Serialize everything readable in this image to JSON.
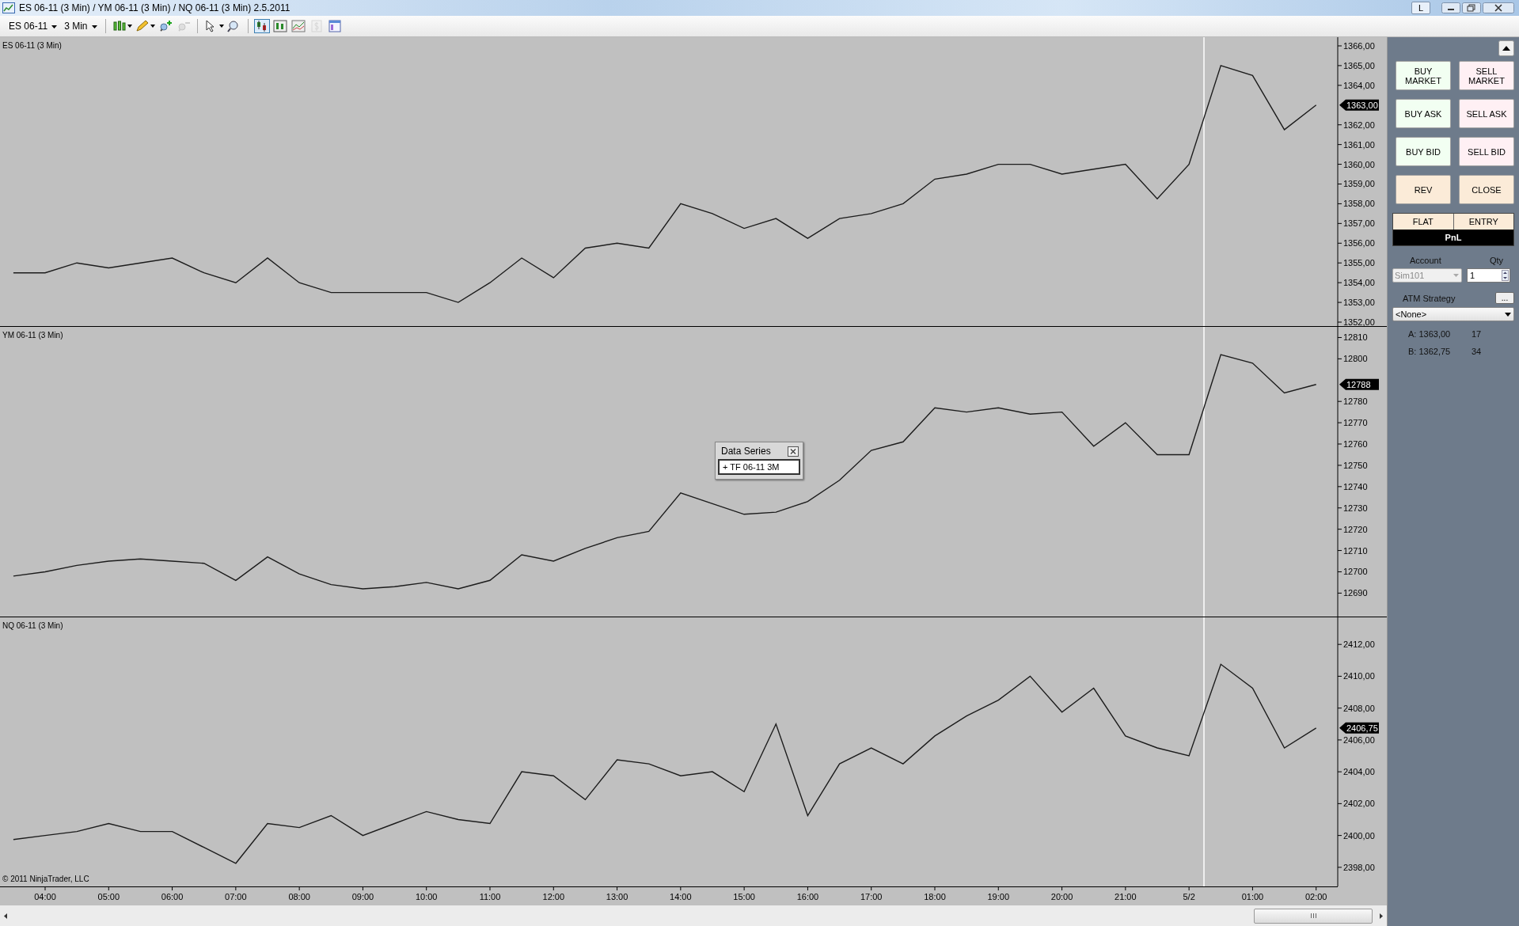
{
  "window": {
    "title": "ES 06-11 (3 Min) / YM 06-11 (3 Min) / NQ 06-11 (3 Min)  2.5.2011",
    "layout_button": "L"
  },
  "toolbar": {
    "instrument": "ES 06-11",
    "interval": "3 Min",
    "tools": [
      {
        "kind": "bars",
        "selected": false,
        "disabled": false
      },
      {
        "kind": "pencil",
        "selected": false,
        "disabled": false
      },
      {
        "kind": "zoom-in",
        "selected": false,
        "disabled": false
      },
      {
        "kind": "zoom-out",
        "selected": false,
        "disabled": true
      },
      {
        "kind": "pointer",
        "selected": false,
        "disabled": false
      },
      {
        "kind": "magnifier",
        "selected": false,
        "disabled": false
      },
      {
        "kind": "data-series",
        "selected": true,
        "disabled": false
      },
      {
        "kind": "indicators",
        "selected": false,
        "disabled": false
      },
      {
        "kind": "strategies",
        "selected": false,
        "disabled": false
      },
      {
        "kind": "dollar",
        "selected": false,
        "disabled": true
      },
      {
        "kind": "properties",
        "selected": false,
        "disabled": false
      }
    ]
  },
  "panels": [
    {
      "title": "ES 06-11 (3 Min)",
      "last_price": "1363,00",
      "chart_data": {
        "type": "line",
        "categories": [
          null,
          null,
          null,
          null,
          null,
          null,
          null,
          null,
          null,
          null,
          null,
          null,
          null,
          null,
          null,
          null,
          null,
          null,
          null,
          null,
          null,
          null,
          null,
          null,
          null,
          null,
          null,
          null,
          null,
          null,
          null,
          null,
          null,
          null,
          null,
          null,
          null,
          null,
          null,
          null,
          null,
          null
        ],
        "series": [
          {
            "color": "#1c1c1c",
            "values": [
              1354.5,
              1354.5,
              1355,
              1354.75,
              1355,
              1355.25,
              1354.5,
              1354,
              1355.25,
              1354,
              1353.5,
              1353.5,
              1353.5,
              1353.5,
              1353,
              1354,
              1355.25,
              1354.25,
              1355.75,
              1356,
              1355.75,
              1358,
              1357.5,
              1356.75,
              1357.25,
              1356.25,
              1357.25,
              1357.5,
              1358,
              1359.25,
              1359.5,
              1360,
              1360,
              1359.5,
              1359.75,
              1360,
              1358.25,
              1360,
              1365,
              1364.5,
              1361.75,
              1363
            ]
          }
        ],
        "ylim": [
          1351.8,
          1366.44
        ],
        "yticks": [
          {
            "value": 1352,
            "label": "1352,00"
          },
          {
            "value": 1353,
            "label": "1353,00"
          },
          {
            "value": 1354,
            "label": "1354,00"
          },
          {
            "value": 1355,
            "label": "1355,00"
          },
          {
            "value": 1356,
            "label": "1356,00"
          },
          {
            "value": 1357,
            "label": "1357,00"
          },
          {
            "value": 1358,
            "label": "1358,00"
          },
          {
            "value": 1359,
            "label": "1359,00"
          },
          {
            "value": 1360,
            "label": "1360,00"
          },
          {
            "value": 1361,
            "label": "1361,00"
          },
          {
            "value": 1362,
            "label": "1362,00"
          },
          {
            "value": 1364,
            "label": "1364,00"
          },
          {
            "value": 1365,
            "label": "1365,00"
          },
          {
            "value": 1366,
            "label": "1366,00"
          }
        ]
      }
    },
    {
      "title": "YM 06-11 (3 Min)",
      "last_price": "12788",
      "chart_data": {
        "type": "line",
        "categories": [
          null,
          null,
          null,
          null,
          null,
          null,
          null,
          null,
          null,
          null,
          null,
          null,
          null,
          null,
          null,
          null,
          null,
          null,
          null,
          null,
          null,
          null,
          null,
          null,
          null,
          null,
          null,
          null,
          null,
          null,
          null,
          null,
          null,
          null,
          null,
          null,
          null,
          null,
          null,
          null,
          null,
          null
        ],
        "series": [
          {
            "color": "#1c1c1c",
            "values": [
              12698,
              12700,
              12703,
              12705,
              12706,
              12705,
              12704,
              12696,
              12707,
              12699,
              12694,
              12692,
              12693,
              12695,
              12692,
              12696,
              12708,
              12705,
              12711,
              12716,
              12719,
              12737,
              12732,
              12727,
              12728,
              12733,
              12743,
              12757,
              12761,
              12777,
              12775,
              12777,
              12774,
              12775,
              12759,
              12770,
              12755,
              12755,
              12802,
              12798,
              12784,
              12788
            ]
          }
        ],
        "ylim": [
          12679,
          12815
        ],
        "yticks": [
          12690,
          12700,
          12710,
          12720,
          12730,
          12740,
          12750,
          12760,
          12770,
          12780,
          12800,
          12810
        ]
      }
    },
    {
      "title": "NQ 06-11 (3 Min)",
      "last_price": "2406,75",
      "footer": "© 2011 NinjaTrader, LLC",
      "chart_data": {
        "type": "line",
        "categories": [
          null,
          "04:00",
          null,
          "05:00",
          null,
          "06:00",
          null,
          "07:00",
          null,
          "08:00",
          null,
          "09:00",
          null,
          "10:00",
          null,
          "11:00",
          null,
          "12:00",
          null,
          "13:00",
          null,
          "14:00",
          null,
          "15:00",
          null,
          "16:00",
          null,
          "17:00",
          null,
          "18:00",
          null,
          "19:00",
          null,
          "20:00",
          null,
          "21:00",
          null,
          "5/2",
          null,
          "01:00",
          null,
          "02:00"
        ],
        "series": [
          {
            "color": "#1c1c1c",
            "values": [
              2399.75,
              2400,
              2400.25,
              2400.75,
              2400.25,
              2400.25,
              2399.25,
              2398.25,
              2400.75,
              2400.5,
              2401.25,
              2400,
              2400.75,
              2401.5,
              2401,
              2400.75,
              2404,
              2403.75,
              2402.25,
              2404.75,
              2404.5,
              2403.75,
              2404,
              2402.75,
              2407,
              2401.25,
              2404.5,
              2405.5,
              2404.5,
              2406.25,
              2407.5,
              2408.5,
              2410,
              2407.75,
              2409.25,
              2406.25,
              2405.5,
              2405,
              2410.75,
              2409.25,
              2405.5,
              2406.75
            ]
          }
        ],
        "ylim": [
          2396.8,
          2413.7
        ],
        "yticks": [
          {
            "value": 2398,
            "label": "2398,00"
          },
          {
            "value": 2400,
            "label": "2400,00"
          },
          {
            "value": 2402,
            "label": "2402,00"
          },
          {
            "value": 2404,
            "label": "2404,00"
          },
          {
            "value": 2406,
            "label": "2406,00"
          },
          {
            "value": 2408,
            "label": "2408,00"
          },
          {
            "value": 2410,
            "label": "2410,00"
          },
          {
            "value": 2412,
            "label": "2412,00"
          }
        ]
      }
    }
  ],
  "data_series_popup": {
    "title": "Data Series",
    "item": "+ TF 06-11 3M"
  },
  "order_panel": {
    "buttons": [
      {
        "label": "BUY\nMARKET",
        "kind": "buy"
      },
      {
        "label": "SELL\nMARKET",
        "kind": "sell"
      },
      {
        "label": "BUY ASK",
        "kind": "buy"
      },
      {
        "label": "SELL ASK",
        "kind": "sell"
      },
      {
        "label": "BUY BID",
        "kind": "buy"
      },
      {
        "label": "SELL BID",
        "kind": "sell"
      },
      {
        "label": "REV",
        "kind": "neutral"
      },
      {
        "label": "CLOSE",
        "kind": "neutral"
      }
    ],
    "position": "FLAT",
    "entry": "ENTRY",
    "pnl": "PnL",
    "account_label": "Account",
    "qty_label": "Qty",
    "account": "Sim101",
    "account_disabled": true,
    "qty": "1",
    "atm_label": "ATM Strategy",
    "atm_button": "...",
    "atm_value": "<None>",
    "quotes": [
      {
        "label": "A: 1363,00",
        "size": "17"
      },
      {
        "label": "B: 1362,75",
        "size": "34"
      }
    ]
  }
}
